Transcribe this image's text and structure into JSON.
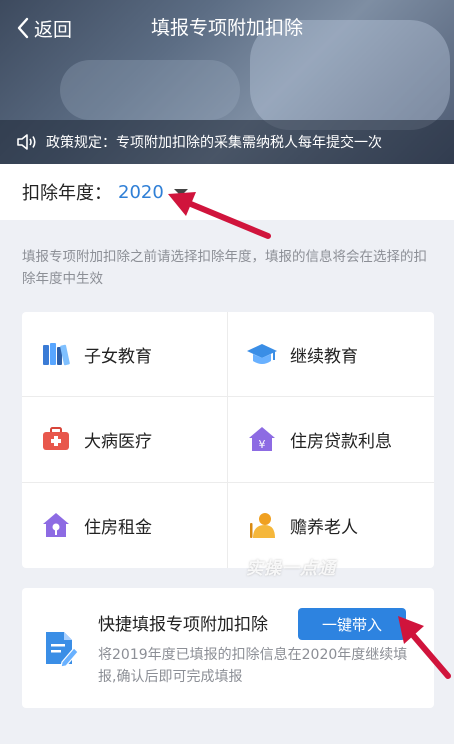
{
  "header": {
    "back_label": "返回",
    "title": "填报专项附加扣除",
    "notice": "政策规定：专项附加扣除的采集需纳税人每年提交一次"
  },
  "year_selector": {
    "label": "扣除年度：",
    "value": "2020"
  },
  "hint": "填报专项附加扣除之前请选择扣除年度，填报的信息将会在选择的扣除年度中生效",
  "categories": [
    {
      "label": "子女教育",
      "icon": "books-icon"
    },
    {
      "label": "继续教育",
      "icon": "graduation-cap-icon"
    },
    {
      "label": "大病医疗",
      "icon": "medical-kit-icon"
    },
    {
      "label": "住房贷款利息",
      "icon": "house-yen-icon"
    },
    {
      "label": "住房租金",
      "icon": "house-key-icon"
    },
    {
      "label": "赡养老人",
      "icon": "elderly-icon"
    }
  ],
  "watermark": "实操一点通",
  "quick_fill": {
    "title": "快捷填报专项附加扣除",
    "button_label": "一键带入",
    "description": "将2019年度已填报的扣除信息在2020年度继续填报,确认后即可完成填报"
  },
  "colors": {
    "accent": "#2d83e0",
    "annotation_arrow": "#d0143c"
  }
}
